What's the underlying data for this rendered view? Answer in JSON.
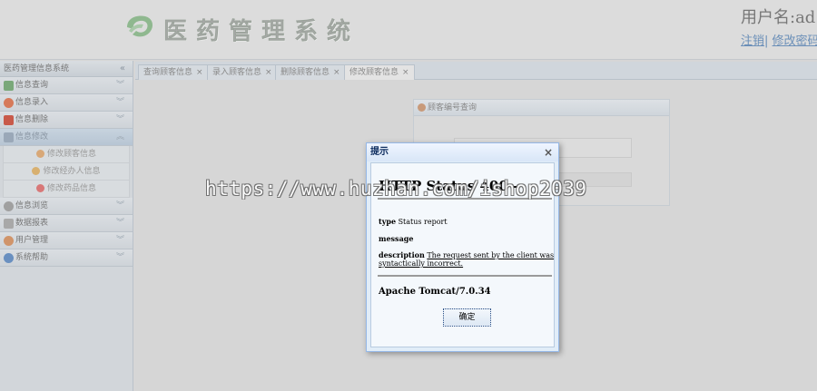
{
  "header": {
    "app_title": "医药管理系统",
    "user_label": "用户名:ad",
    "logout_label": "注销",
    "separator": "|",
    "change_password_label": "修改密码"
  },
  "sidebar": {
    "title": "医药管理信息系统",
    "collapse_glyph": "«",
    "groups": [
      {
        "label": "信息查询",
        "icon": "search-list-icon",
        "color": "#5a9a5a",
        "expanded": false
      },
      {
        "label": "信息录入",
        "icon": "add-icon",
        "color": "#d65c3a",
        "expanded": false
      },
      {
        "label": "信息删除",
        "icon": "delete-icon",
        "color": "#c83a2a",
        "expanded": false
      },
      {
        "label": "信息修改",
        "icon": "edit-icon",
        "color": "#7a8aa0",
        "expanded": true
      },
      {
        "label": "信息浏览",
        "icon": "browse-icon",
        "color": "#8a8a8a",
        "expanded": false
      },
      {
        "label": "数据报表",
        "icon": "report-icon",
        "color": "#8a8a8a",
        "expanded": false
      },
      {
        "label": "用户管理",
        "icon": "user-icon",
        "color": "#c8864a",
        "expanded": false
      },
      {
        "label": "系统帮助",
        "icon": "help-icon",
        "color": "#4a7ab8",
        "expanded": false
      }
    ],
    "sub_items": [
      {
        "label": "修改顾客信息",
        "icon": "customer-icon",
        "color": "#d8a050"
      },
      {
        "label": "修改经办人信息",
        "icon": "agent-icon",
        "color": "#d8a050"
      },
      {
        "label": "修改药品信息",
        "icon": "medicine-icon",
        "color": "#d86060"
      }
    ]
  },
  "tabs": [
    {
      "label": "查询顾客信息",
      "active": false
    },
    {
      "label": "录入顾客信息",
      "active": false
    },
    {
      "label": "删除顾客信息",
      "active": false
    },
    {
      "label": "修改顾客信息",
      "active": true
    }
  ],
  "tab_close_glyph": "×",
  "panel": {
    "title": "顾客编号查询"
  },
  "dialog": {
    "title": "提示",
    "close_glyph": "×",
    "http_title": "HTTP Status 400 -",
    "type_label": "type",
    "type_value": "Status report",
    "message_label": "message",
    "description_label": "description",
    "description_line1": "The request sent by the client was",
    "description_line2": "syntactically incorrect.",
    "server": "Apache Tomcat/7.0.34",
    "ok_label": "确定"
  },
  "watermark": "https://www.huzhan.com/ishop2039",
  "colors": {
    "dialog_border": "#95b8e7",
    "dialog_bg": "#e1edf8",
    "link": "#6b8fb8"
  }
}
